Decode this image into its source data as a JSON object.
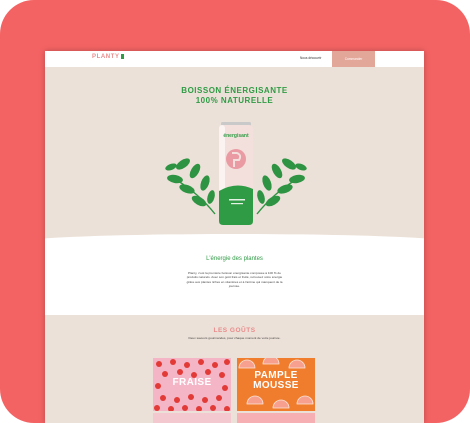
{
  "nav": {
    "logo": "PLANTY",
    "link": "Nous découvrir",
    "cta": "Commander"
  },
  "hero": {
    "title_line1": "BOISSON ÉNERGISANTE",
    "title_line2": "100% NATURELLE",
    "can_brand": "énergisant"
  },
  "about": {
    "title": "L'énergie des plantes",
    "text": "Planty, c'est la première boisson énergisante composée à 100 % de produits naturels. Avec son goût frais et fruité, retrouvez votre énergie grâce aux plantes riches en vitamines et à l'arôme qui manquent de la journée."
  },
  "tastes": {
    "title": "LES GOÛTS",
    "subtitle": "Deux saveurs gourmandes, pour chaque moment de votre journée.",
    "flavors": [
      {
        "name": "FRAISE"
      },
      {
        "name_line1": "PAMPLE",
        "name_line2": "MOUSSE"
      }
    ]
  },
  "colors": {
    "frame": "#f46364",
    "background": "#ece1d8",
    "green": "#2f9b45",
    "pink": "#e98b8b"
  }
}
